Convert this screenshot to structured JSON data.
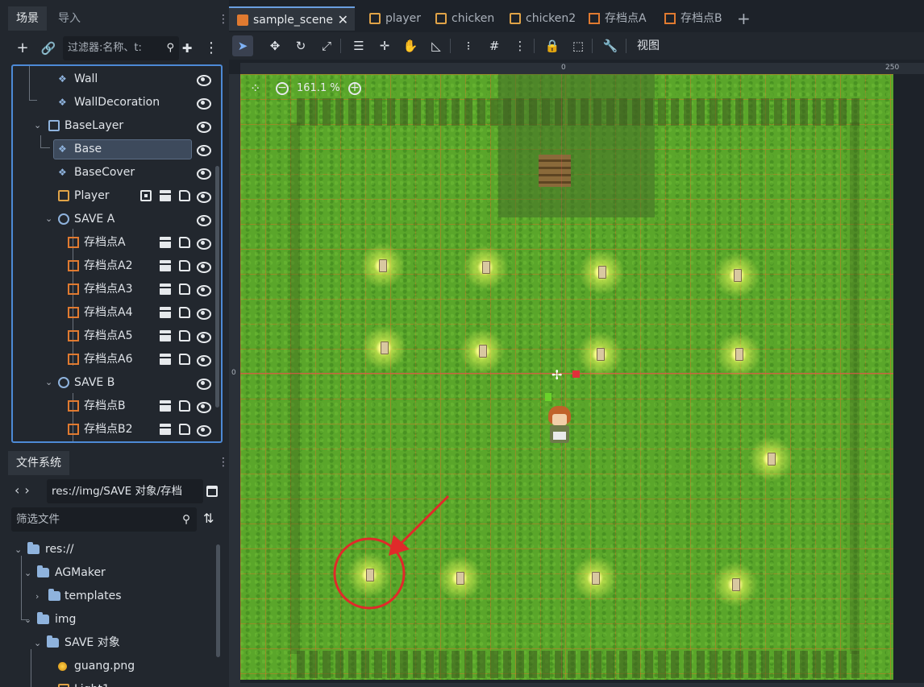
{
  "left_dock": {
    "tabs": [
      {
        "label": "场景"
      },
      {
        "label": "导入"
      }
    ],
    "scene_filter_placeholder": "过滤器:名称、t:",
    "tree": [
      {
        "label": "Wall"
      },
      {
        "label": "WallDecoration"
      },
      {
        "label": "BaseLayer"
      },
      {
        "label": "Base"
      },
      {
        "label": "BaseCover"
      },
      {
        "label": "Player"
      },
      {
        "label": "SAVE A"
      },
      {
        "label": "存档点A"
      },
      {
        "label": "存档点A2"
      },
      {
        "label": "存档点A3"
      },
      {
        "label": "存档点A4"
      },
      {
        "label": "存档点A5"
      },
      {
        "label": "存档点A6"
      },
      {
        "label": "SAVE B"
      },
      {
        "label": "存档点B"
      },
      {
        "label": "存档点B2"
      }
    ],
    "selected_node": "Base"
  },
  "filesystem": {
    "tab_label": "文件系统",
    "path": "res://img/SAVE 对象/存档",
    "filter_placeholder": "筛选文件",
    "items": [
      {
        "label": "res://"
      },
      {
        "label": "AGMaker"
      },
      {
        "label": "templates"
      },
      {
        "label": "img"
      },
      {
        "label": "SAVE 对象"
      },
      {
        "label": "guang.png"
      },
      {
        "label": "Light1"
      }
    ]
  },
  "editor_tabs": [
    {
      "label": "sample_scene",
      "active": true
    },
    {
      "label": "player"
    },
    {
      "label": "chicken"
    },
    {
      "label": "chicken2"
    },
    {
      "label": "存档点A"
    },
    {
      "label": "存档点B"
    }
  ],
  "toolbar": {
    "view_label": "视图"
  },
  "viewport": {
    "zoom_label": "161.1 %",
    "ruler_labels": {
      "top_zero": "0",
      "top_250": "250",
      "left_zero": "0"
    }
  },
  "colors": {
    "accent": "#4d8ad6",
    "grass": "#5aa62a",
    "annotation": "#e02a2a"
  }
}
